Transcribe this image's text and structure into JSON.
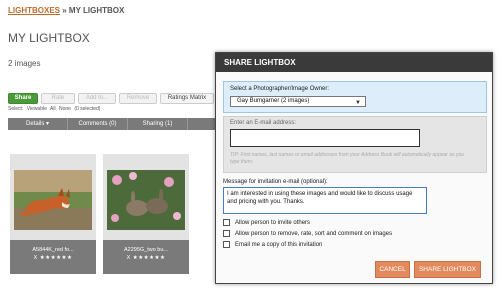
{
  "breadcrumb": {
    "link": "LIGHTBOXES",
    "separator": " » ",
    "current": "MY LIGHTBOX"
  },
  "page_title": "MY LIGHTBOX",
  "image_count": "2 images",
  "toolbar": {
    "share": "Share",
    "rate": "Rate",
    "add_to": "Add to...",
    "remove": "Remove",
    "ratings_matrix": "Ratings Matrix"
  },
  "select_row": {
    "label": "Select:",
    "viewable": "Viewable",
    "all": "All",
    "none": "None",
    "selected": "(0 selected)"
  },
  "tabs": {
    "details": "Details ▾",
    "comments": "Comments (0)",
    "sharing": "Sharing (1)"
  },
  "thumbnails": [
    {
      "name": "A5844K_red fo...",
      "stars": "X ★★★★★★"
    },
    {
      "name": "A2295G_two bu...",
      "stars": "X ★★★★★★"
    }
  ],
  "modal": {
    "title": "SHARE LIGHTBOX",
    "owner_label": "Select a Photographer/Image Owner:",
    "owner_value": "Gay Bumgarner (2 images)",
    "email_label": "Enter an E-mail address:",
    "email_value": "",
    "email_hint": "TIP: First names, last names or email addresses from your Address Book will automatically appear as you type them.",
    "message_label": "Message for invitation e-mail (optional):",
    "message_value": "I am interested in using these images and would like to discuss usage and pricing with you. Thanks.",
    "options": {
      "invite_others": "Allow person to invite others",
      "remove_rate": "Allow person to remove, rate, sort and comment on images",
      "email_copy": "Email me a copy of this invitation"
    },
    "cancel": "CANCEL",
    "share": "SHARE LIGHTBOX"
  },
  "colors": {
    "accent_link": "#c06a2b",
    "share_green": "#4a9a3a",
    "modal_header": "#3a3a3a",
    "button_orange": "#e28a5c",
    "owner_box_bg": "#ddeefa"
  }
}
